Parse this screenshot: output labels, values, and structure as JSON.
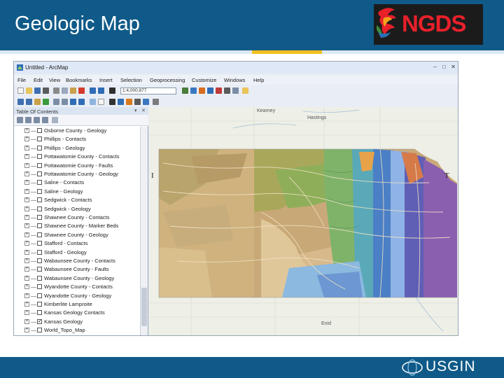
{
  "slide": {
    "title": "Geologic Map",
    "logo_text": "NGDS",
    "footer_logo_text": "USGIN",
    "colors": {
      "header": "#0f5a88",
      "accent": "#f0c020",
      "logo_red": "#e8202a"
    }
  },
  "window": {
    "title": "Untitled - ArcMap",
    "controls": {
      "minimize": "–",
      "maximize": "□",
      "close": "✕"
    }
  },
  "menubar": [
    "File",
    "Edit",
    "View",
    "Bookmarks",
    "Insert",
    "Selection",
    "Geoprocessing",
    "Customize",
    "Windows",
    "Help"
  ],
  "toolbar": {
    "scale": "1:4,000,877"
  },
  "toc": {
    "title": "Table Of Contents",
    "pin": "▾",
    "close": "✕",
    "layers": [
      {
        "name": "Osborne County - Geology",
        "checked": false
      },
      {
        "name": "Phillips - Contacts",
        "checked": false
      },
      {
        "name": "Phillips - Geology",
        "checked": false
      },
      {
        "name": "Pottawatomie County - Contacts",
        "checked": false
      },
      {
        "name": "Pottawatomie County - Faults",
        "checked": false
      },
      {
        "name": "Pottawatomie County - Geology",
        "checked": false
      },
      {
        "name": "Saline - Contacts",
        "checked": false
      },
      {
        "name": "Saline - Geology",
        "checked": false
      },
      {
        "name": "Sedgwick - Contacts",
        "checked": false
      },
      {
        "name": "Sedgwick - Geology",
        "checked": false
      },
      {
        "name": "Shawnee County - Contacts",
        "checked": false
      },
      {
        "name": "Shawnee County - Marker Beds",
        "checked": false
      },
      {
        "name": "Shawnee County - Geology",
        "checked": false
      },
      {
        "name": "Stafford - Contacts",
        "checked": false
      },
      {
        "name": "Stafford - Geology",
        "checked": false
      },
      {
        "name": "Wabaunsee County - Contacts",
        "checked": false
      },
      {
        "name": "Wabaunsee County - Faults",
        "checked": false
      },
      {
        "name": "Wabaunsee County - Geology",
        "checked": false
      },
      {
        "name": "Wyandotte County - Contacts",
        "checked": false
      },
      {
        "name": "Wyandotte County - Geology",
        "checked": false
      },
      {
        "name": "Kimberlite Lamproite",
        "checked": false
      },
      {
        "name": "Kansas Geology Contacts",
        "checked": false
      },
      {
        "name": "Kansas Geology",
        "checked": true
      },
      {
        "name": "World_Topo_Map",
        "checked": false
      }
    ]
  },
  "map": {
    "places": {
      "kearney": "Kearney",
      "hastings": "Hastings",
      "enid": "Enid"
    },
    "nav_left": "I",
    "nav_right": "T"
  }
}
